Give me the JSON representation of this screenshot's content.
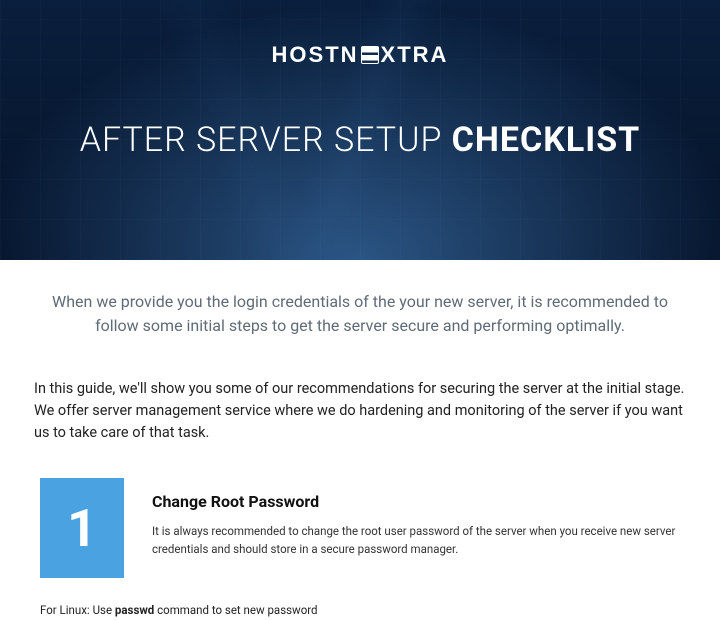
{
  "logo": {
    "part1": "HOSTN",
    "part2": "XTRA"
  },
  "hero": {
    "title_light": "AFTER SERVER SETUP ",
    "title_bold": "CHECKLIST"
  },
  "intro": "When we provide you the login credentials of the your new server, it is recommended to follow some initial steps to get the server secure and performing optimally.",
  "guide": "In this guide, we'll show you some of our recommendations for securing the server at the initial stage. We offer server management service where we do hardening and monitoring of the server if you want us to take care of that task.",
  "step1": {
    "num": "1",
    "title": "Change Root Password",
    "desc": "It is always recommended to change the root user password of the server when you receive new server credentials and should store in a secure password manager.",
    "note_prefix": "For Linux: Use ",
    "note_cmd": "passwd",
    "note_suffix": " command to set new password"
  }
}
